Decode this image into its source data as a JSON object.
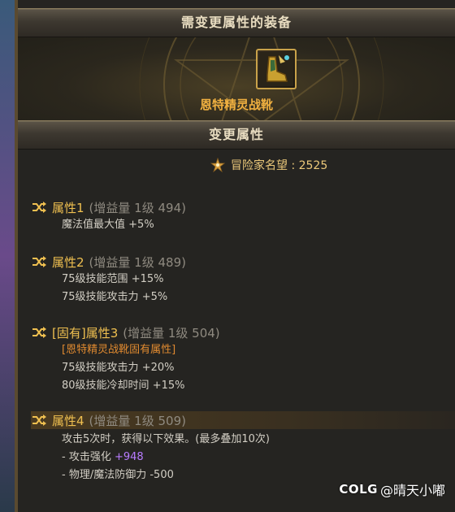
{
  "header": {
    "title": "需变更属性的装备"
  },
  "item": {
    "name": "恩特精灵战靴",
    "icon": "boots-icon"
  },
  "section": {
    "title": "变更属性"
  },
  "fame": {
    "label": "冒险家名望 : 2525",
    "icon": "fame-icon"
  },
  "attributes": [
    {
      "name": "属性1",
      "gain": "(增益量 1级 494)",
      "lines": [
        {
          "text": "魔法值最大值",
          "value": "+5%"
        }
      ]
    },
    {
      "name": "属性2",
      "gain": "(增益量 1级 489)",
      "lines": [
        {
          "text": "75级技能范围",
          "value": "+15%"
        },
        {
          "text": "75级技能攻击力",
          "value": "+5%"
        }
      ]
    },
    {
      "name": "[固有]属性3",
      "gain": "(增益量 1级 504)",
      "note": "[恩特精灵战靴固有属性]",
      "lines": [
        {
          "text": "75级技能攻击力",
          "value": "+20%"
        },
        {
          "text": "80级技能冷却时间",
          "value": "+15%"
        }
      ]
    },
    {
      "name": "属性4",
      "gain": "(增益量 1级 509)",
      "selected": true,
      "lines": [
        {
          "text": "攻击5次时，获得以下效果。(最多叠加10次)",
          "value": ""
        },
        {
          "text": "- 攻击强化",
          "value": "+948"
        },
        {
          "text": "- 物理/魔法防御力",
          "value": "-500"
        }
      ]
    }
  ],
  "watermark": {
    "logo": "COLG",
    "text": "@晴天小嘟"
  },
  "colors": {
    "attr_name": "#f0c050",
    "item_name": "#f0b040",
    "note": "#e08a30",
    "highlight": "#b87cff"
  }
}
